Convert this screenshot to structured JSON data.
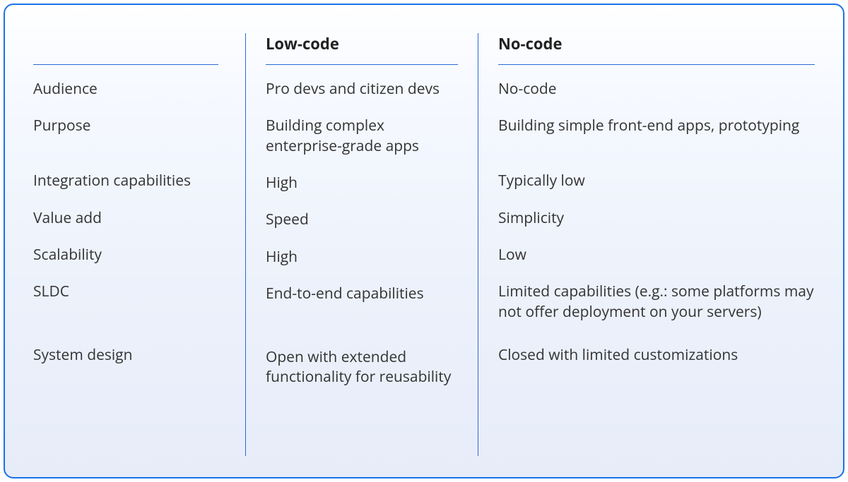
{
  "columns": {
    "criteria_header": "",
    "lowcode_header": "Low-code",
    "nocode_header": "No-code"
  },
  "rows": {
    "audience": {
      "criteria": "Audience",
      "lowcode": "Pro devs and citizen devs",
      "nocode": "No-code"
    },
    "purpose": {
      "criteria": "Purpose",
      "lowcode": "Building complex enterprise-grade apps",
      "nocode": "Building simple front-end apps, prototyping"
    },
    "integration": {
      "criteria": "Integration capabilities",
      "lowcode": "High",
      "nocode": "Typically low"
    },
    "value_add": {
      "criteria": "Value add",
      "lowcode": "Speed",
      "nocode": "Simplicity"
    },
    "scalability": {
      "criteria": "Scalability",
      "lowcode": "High",
      "nocode": "Low"
    },
    "sldc": {
      "criteria": "SLDC",
      "lowcode": "End-to-end capabilities",
      "nocode": "Limited capabilities (e.g.: some platforms may not offer deployment on your servers)"
    },
    "system_design": {
      "criteria": "System design",
      "lowcode": "Open with extended functionality for reusability",
      "nocode": "Closed with limited customizations"
    }
  }
}
